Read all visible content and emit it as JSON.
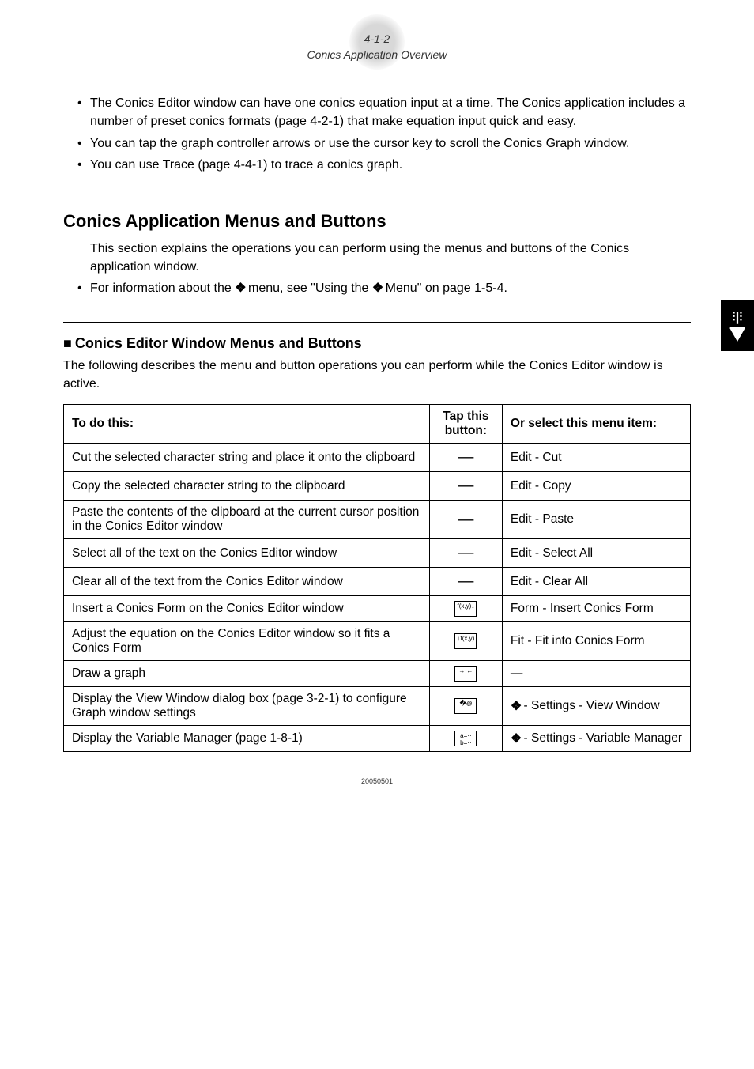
{
  "header": {
    "page_ref": "4-1-2",
    "title": "Conics Application Overview"
  },
  "intro_bullets": [
    "The Conics Editor window can have one conics equation input at a time. The Conics application includes a number of preset conics formats (page 4-2-1) that make equation input quick and easy.",
    "You can tap the graph controller arrows or use the cursor key to scroll the Conics Graph window.",
    "You can use Trace (page 4-4-1) to trace a conics graph."
  ],
  "section": {
    "title": "Conics Application Menus and Buttons",
    "desc": "This section explains the operations you can perform using the menus and buttons of the Conics application window.",
    "bullet_prefix": "For information about the ",
    "bullet_mid": " menu, see \"Using the ",
    "bullet_suffix": " Menu\" on page 1-5-4."
  },
  "subsection": {
    "square": "■",
    "title": "Conics Editor Window Menus and Buttons",
    "desc": "The following describes the menu and button operations you can perform while the Conics Editor window is active."
  },
  "table": {
    "headers": {
      "c1": "To do this:",
      "c2": "Tap this button:",
      "c3": "Or select this menu item:"
    },
    "rows": [
      {
        "action": "Cut the selected character string and place it onto the clipboard",
        "btn_type": "dash",
        "menu": "Edit - Cut"
      },
      {
        "action": "Copy the selected character string to the clipboard",
        "btn_type": "dash",
        "menu": "Edit - Copy"
      },
      {
        "action": "Paste the contents of the clipboard at the current cursor position in the Conics Editor window",
        "btn_type": "dash",
        "menu": "Edit - Paste"
      },
      {
        "action": "Select all of the text on the Conics Editor window",
        "btn_type": "dash",
        "menu": "Edit - Select All"
      },
      {
        "action": "Clear all of the text from the Conics Editor window",
        "btn_type": "dash",
        "menu": "Edit - Clear All"
      },
      {
        "action": "Insert a Conics Form on the Conics Editor window",
        "btn_type": "icon",
        "btn_glyph": "f(x,y)↓",
        "menu": "Form - Insert Conics Form"
      },
      {
        "action": "Adjust the equation on the Conics Editor window so it fits a Conics Form",
        "btn_type": "icon",
        "btn_glyph": "↓f(x,y)",
        "menu": "Fit - Fit into Conics Form"
      },
      {
        "action": "Draw a graph",
        "btn_type": "icon",
        "btn_glyph": "→|←",
        "menu": "—"
      },
      {
        "action": "Display the View Window dialog box (page 3-2-1) to configure Graph window settings",
        "btn_type": "icon",
        "btn_glyph": "�꩜",
        "menu_prefix": " - Settings - View Window",
        "menu_icon": true
      },
      {
        "action": "Display the Variable Manager (page 1-8-1)",
        "btn_type": "icon",
        "btn_glyph": "a=··\nb=··",
        "menu_prefix": " - Settings - Variable Manager",
        "menu_icon": true
      }
    ]
  },
  "footer_code": "20050501",
  "glyphs": {
    "settings_icon_alt": "settings-menu-icon"
  }
}
